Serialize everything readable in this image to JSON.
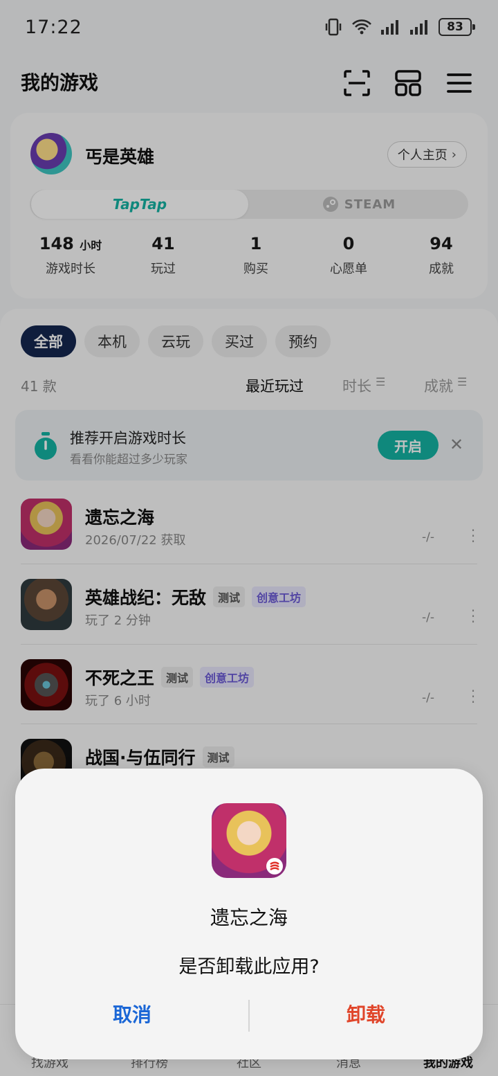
{
  "status_bar": {
    "time": "17:22",
    "battery": "83"
  },
  "header": {
    "title": "我的游戏"
  },
  "profile": {
    "username": "丐是英雄",
    "homepage_label": "个人主页",
    "platforms": {
      "taptap": "TapTap",
      "steam": "STEAM"
    },
    "stats": [
      {
        "value": "148",
        "unit": "小时",
        "label": "游戏时长"
      },
      {
        "value": "41",
        "unit": "",
        "label": "玩过"
      },
      {
        "value": "1",
        "unit": "",
        "label": "购买"
      },
      {
        "value": "0",
        "unit": "",
        "label": "心愿单"
      },
      {
        "value": "94",
        "unit": "",
        "label": "成就"
      }
    ]
  },
  "filters": [
    "全部",
    "本机",
    "云玩",
    "买过",
    "预约"
  ],
  "list_header": {
    "count": "41 款",
    "sort_recent": "最近玩过",
    "sort_duration": "时长",
    "sort_achievements": "成就"
  },
  "banner": {
    "title": "推荐开启游戏时长",
    "subtitle": "看看你能超过多少玩家",
    "button": "开启"
  },
  "games": [
    {
      "name": "遗忘之海",
      "sub": "2026/07/22 获取",
      "meta": "-/-",
      "tags": []
    },
    {
      "name": "英雄战纪：无敌",
      "sub": "玩了 2 分钟",
      "meta": "-/-",
      "tags": [
        "测试",
        "创意工坊"
      ]
    },
    {
      "name": "不死之王",
      "sub": "玩了 6 小时",
      "meta": "-/-",
      "tags": [
        "测试",
        "创意工坊"
      ]
    },
    {
      "name": "战国·与伍同行",
      "sub": "",
      "meta": "",
      "tags": [
        "测试"
      ]
    }
  ],
  "bottom_nav": [
    "找游戏",
    "排行榜",
    "社区",
    "消息",
    "我的游戏"
  ],
  "dialog": {
    "app_name": "遗忘之海",
    "message": "是否卸载此应用?",
    "cancel": "取消",
    "confirm": "卸载"
  },
  "colors": {
    "accent": "#15b3a4",
    "chip_active": "#14274f",
    "cancel": "#1a66d6",
    "danger": "#e0452a"
  }
}
